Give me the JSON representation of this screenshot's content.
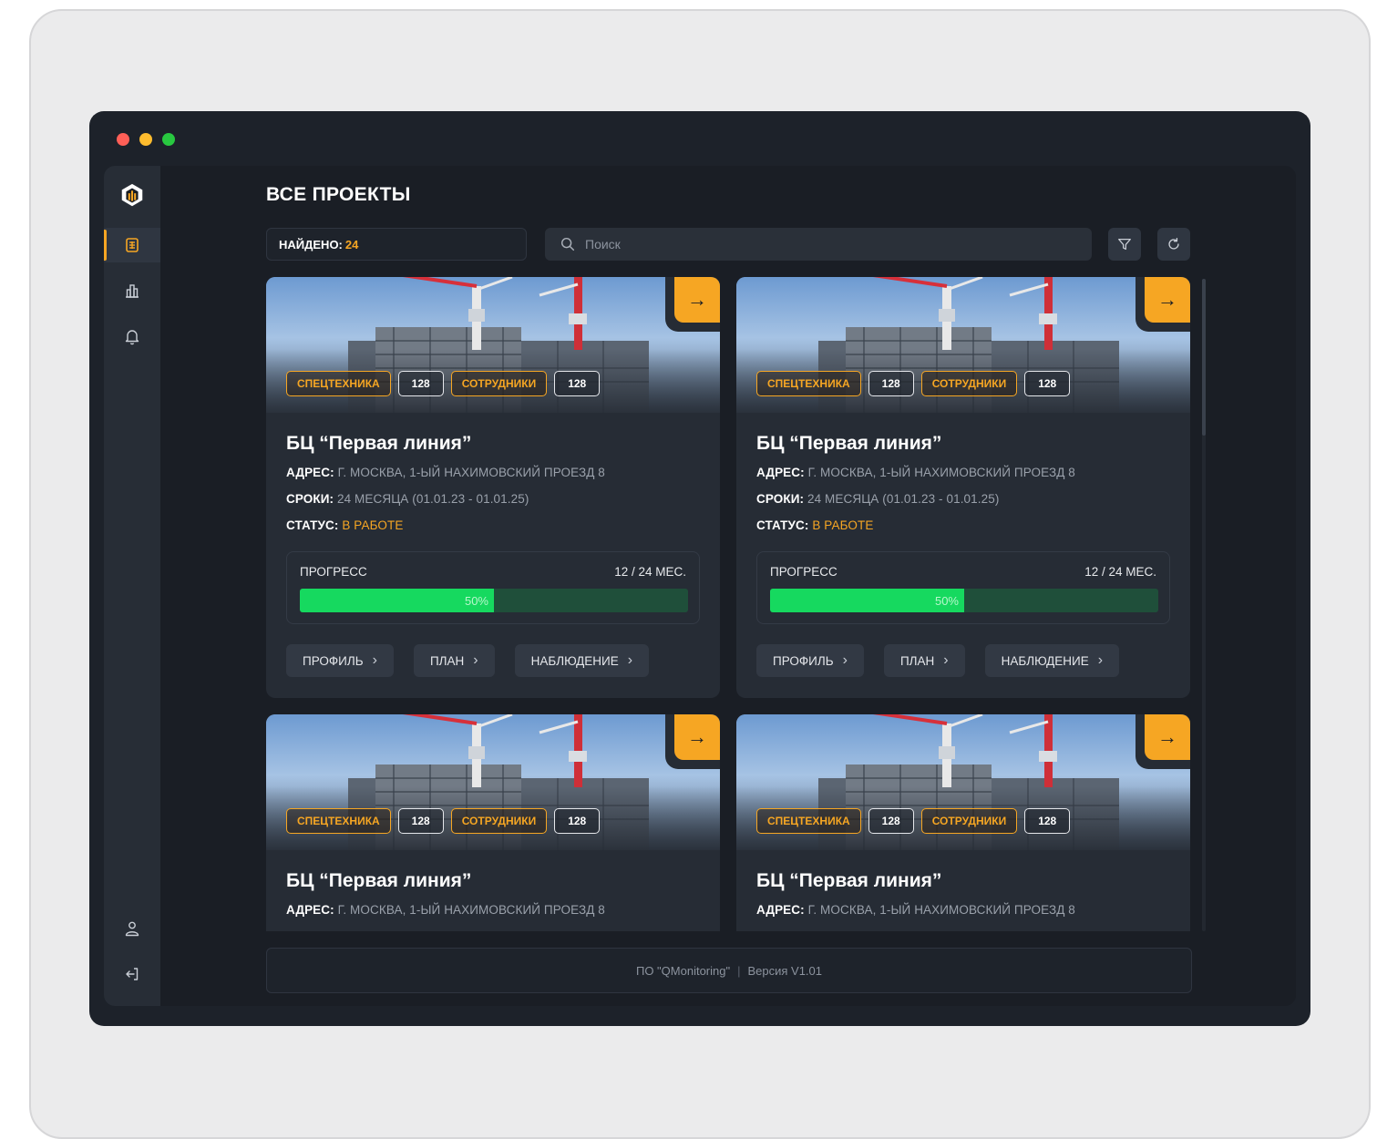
{
  "app": {
    "page_title": "ВСЕ ПРОЕКТЫ",
    "found_label": "НАЙДЕНО:",
    "found_count": "24",
    "search_placeholder": "Поиск"
  },
  "sidebar": {
    "items": [
      {
        "name": "projects",
        "icon": "building-icon",
        "active": true
      },
      {
        "name": "analytics",
        "icon": "chart-icon",
        "active": false
      },
      {
        "name": "notifications",
        "icon": "bell-icon",
        "active": false
      }
    ],
    "bottom_items": [
      {
        "name": "profile",
        "icon": "user-icon"
      },
      {
        "name": "logout",
        "icon": "logout-icon"
      }
    ]
  },
  "cards": [
    {
      "tag1": "СПЕЦТЕХНИКА",
      "tag1_count": "128",
      "tag2": "СОТРУДНИКИ",
      "tag2_count": "128",
      "title": "БЦ “Первая линия”",
      "address_label": "АДРЕС:",
      "address": "Г. МОСКВА, 1-ЫЙ НАХИМОВСКИЙ ПРОЕЗД 8",
      "terms_label": "СРОКИ:",
      "terms": "24 МЕСЯЦА (01.01.23 - 01.01.25)",
      "status_label": "СТАТУС:",
      "status": "В РАБОТЕ",
      "progress_label": "ПРОГРЕСС",
      "progress_value": "12 / 24 МЕС.",
      "progress_percent": "50%",
      "progress_fraction": 0.5,
      "btn_profile": "ПРОФИЛЬ",
      "btn_plan": "ПЛАН",
      "btn_watch": "НАБЛЮДЕНИЕ"
    },
    {
      "tag1": "СПЕЦТЕХНИКА",
      "tag1_count": "128",
      "tag2": "СОТРУДНИКИ",
      "tag2_count": "128",
      "title": "БЦ “Первая линия”",
      "address_label": "АДРЕС:",
      "address": "Г. МОСКВА, 1-ЫЙ НАХИМОВСКИЙ ПРОЕЗД 8",
      "terms_label": "СРОКИ:",
      "terms": "24 МЕСЯЦА (01.01.23 - 01.01.25)",
      "status_label": "СТАТУС:",
      "status": "В РАБОТЕ",
      "progress_label": "ПРОГРЕСС",
      "progress_value": "12 / 24 МЕС.",
      "progress_percent": "50%",
      "progress_fraction": 0.5,
      "btn_profile": "ПРОФИЛЬ",
      "btn_plan": "ПЛАН",
      "btn_watch": "НАБЛЮДЕНИЕ"
    },
    {
      "tag1": "СПЕЦТЕХНИКА",
      "tag1_count": "128",
      "tag2": "СОТРУДНИКИ",
      "tag2_count": "128",
      "title": "БЦ “Первая линия”",
      "address_label": "АДРЕС:",
      "address": "Г. МОСКВА, 1-ЫЙ НАХИМОВСКИЙ ПРОЕЗД 8"
    },
    {
      "tag1": "СПЕЦТЕХНИКА",
      "tag1_count": "128",
      "tag2": "СОТРУДНИКИ",
      "tag2_count": "128",
      "title": "БЦ “Первая линия”",
      "address_label": "АДРЕС:",
      "address": "Г. МОСКВА, 1-ЫЙ НАХИМОВСКИЙ ПРОЕЗД 8"
    }
  ],
  "footer": {
    "product": "ПО \"QMonitoring\"",
    "separator": "|",
    "version": "Версия V1.01"
  },
  "colors": {
    "accent": "#f6a623",
    "progress": "#16d95f",
    "progress_track": "#1f4f3a",
    "background": "#1a1e25",
    "card": "#262c35"
  }
}
